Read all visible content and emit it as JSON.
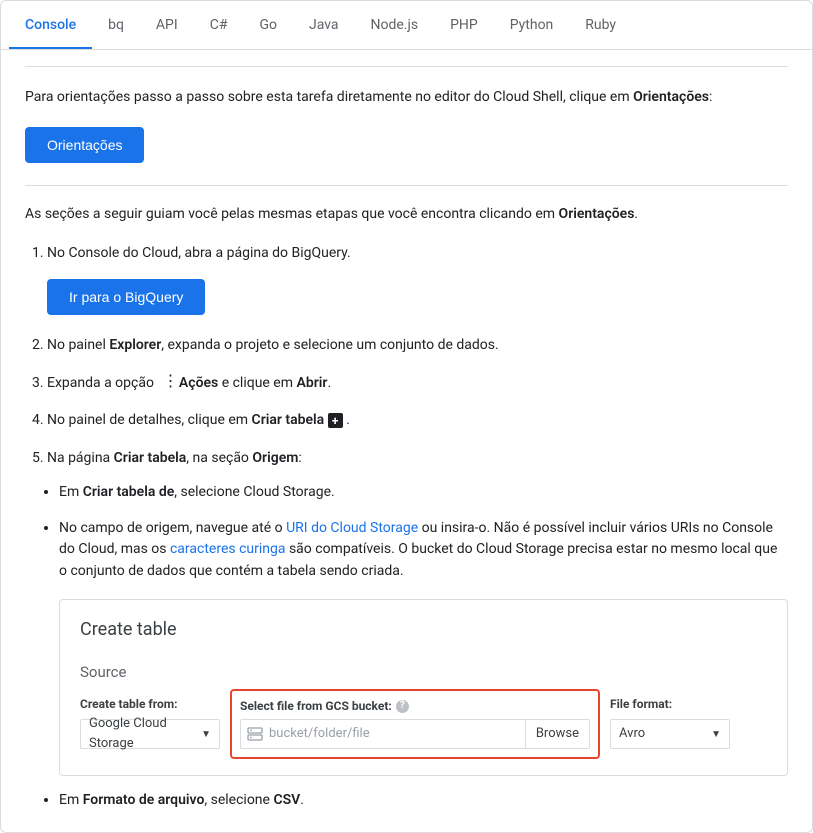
{
  "tabs": [
    "Console",
    "bq",
    "API",
    "C#",
    "Go",
    "Java",
    "Node.js",
    "PHP",
    "Python",
    "Ruby"
  ],
  "intro_pre": "Para orientações passo a passo sobre esta tarefa diretamente no editor do Cloud Shell, clique em ",
  "intro_bold": "Orientações",
  "colon": ":",
  "btn_orientacoes": "Orientações",
  "sections_pre": "As seções a seguir guiam você pelas mesmas etapas que você encontra clicando em ",
  "sections_bold": "Orientações",
  "period": ".",
  "steps": {
    "s1": "No Console do Cloud, abra a página do BigQuery.",
    "s1_btn": "Ir para o BigQuery",
    "s2_pre": "No painel ",
    "s2_b1": "Explorer",
    "s2_post": ", expanda o projeto e selecione um conjunto de dados.",
    "s3_pre": "Expanda a opção ",
    "s3_b1": "Ações",
    "s3_mid": " e clique em ",
    "s3_b2": "Abrir",
    "s4_pre": "No painel de detalhes, clique em ",
    "s4_b1": "Criar tabela",
    "s5_pre": "Na página ",
    "s5_b1": "Criar tabela",
    "s5_mid": ", na seção ",
    "s5_b2": "Origem",
    "bullets": {
      "b1_pre": "Em ",
      "b1_b": "Criar tabela de",
      "b1_post": ", selecione Cloud Storage.",
      "b2_pre": "No campo de origem, navegue até o ",
      "b2_link1": "URI do Cloud Storage",
      "b2_mid": " ou insira-o. Não é possível incluir vários URIs no Console do Cloud, mas os ",
      "b2_link2": "caracteres curinga",
      "b2_post": " são compatíveis. O bucket do Cloud Storage precisa estar no mesmo local que o conjunto de dados que contém a tabela sendo criada.",
      "b3_pre": "Em ",
      "b3_b": "Formato de arquivo",
      "b3_post": ", selecione ",
      "b3_b2": "CSV"
    }
  },
  "form": {
    "title": "Create table",
    "source": "Source",
    "create_from_label": "Create table from:",
    "create_from_value": "Google Cloud Storage",
    "select_label": "Select file from GCS bucket:",
    "placeholder": "bucket/folder/file",
    "browse": "Browse",
    "format_label": "File format:",
    "format_value": "Avro"
  }
}
